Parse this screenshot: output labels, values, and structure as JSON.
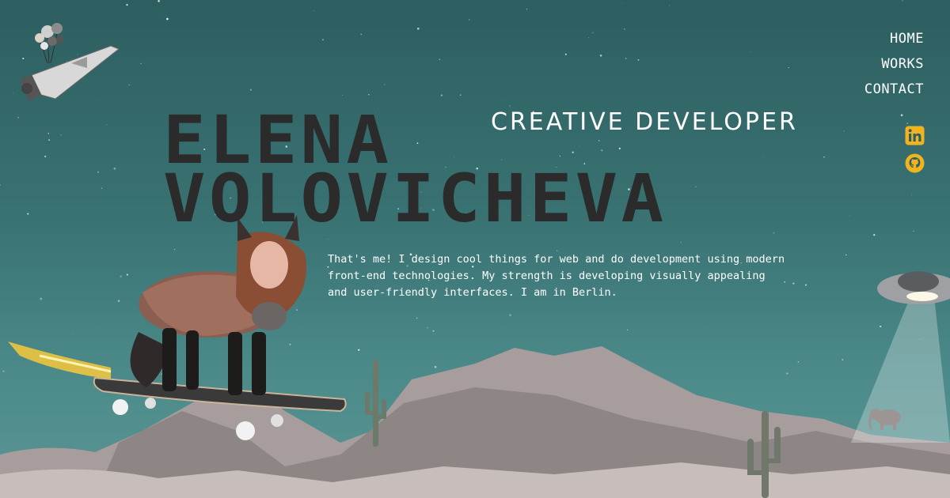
{
  "nav": {
    "home": "HOME",
    "works": "WORKS",
    "contact": "CONTACT"
  },
  "hero": {
    "name_first": "ELENA",
    "name_last": "VOLOVICHEVA",
    "subtitle": "CREATIVE DEVELOPER",
    "bio": "That's me! I design cool things for web and do development using modern front-end technologies. My strength is developing visually appealing and user-friendly interfaces. I am in Berlin."
  },
  "socials": {
    "linkedin_icon": "linkedin-icon",
    "github_icon": "github-icon"
  },
  "colors": {
    "sky": "#3a7373",
    "name_text": "#2b2b2b",
    "social_accent": "#f2b320",
    "rock": "#b8adac"
  }
}
